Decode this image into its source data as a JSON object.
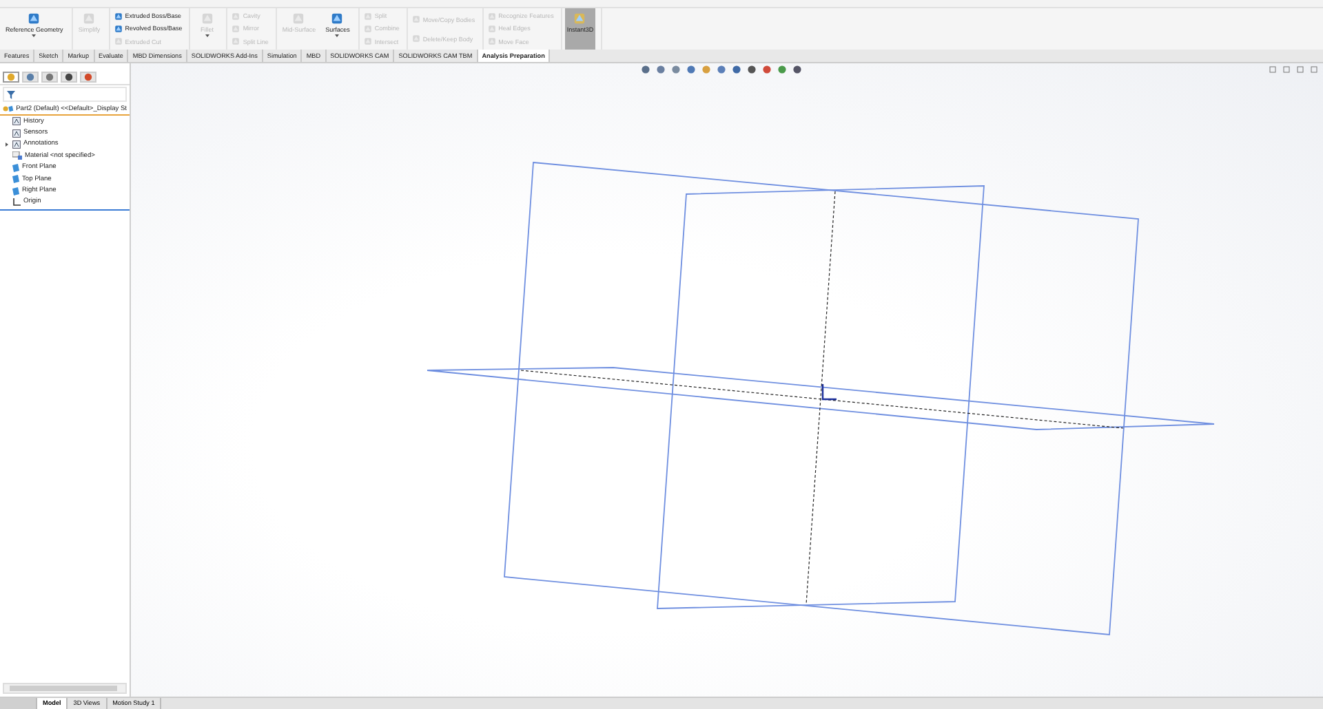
{
  "ribbon": {
    "groups": [
      {
        "kind": "large",
        "items": [
          {
            "label": "Reference Geometry",
            "disabled": false,
            "caret": true
          }
        ]
      },
      {
        "kind": "large",
        "items": [
          {
            "label": "Simplify",
            "disabled": true,
            "caret": false
          }
        ]
      },
      {
        "kind": "column",
        "items": [
          {
            "label": "Extruded Boss/Base",
            "disabled": false
          },
          {
            "label": "Revolved Boss/Base",
            "disabled": false
          },
          {
            "label": "Extruded Cut",
            "disabled": true
          }
        ]
      },
      {
        "kind": "large",
        "items": [
          {
            "label": "Fillet",
            "disabled": true,
            "caret": true
          }
        ]
      },
      {
        "kind": "column",
        "items": [
          {
            "label": "Cavity",
            "disabled": true
          },
          {
            "label": "Mirror",
            "disabled": true
          },
          {
            "label": "Split Line",
            "disabled": true
          }
        ]
      },
      {
        "kind": "large",
        "items": [
          {
            "label": "Mid-Surface",
            "disabled": true,
            "caret": false
          },
          {
            "label": "Surfaces",
            "disabled": false,
            "caret": true
          }
        ]
      },
      {
        "kind": "column",
        "items": [
          {
            "label": "Split",
            "disabled": true
          },
          {
            "label": "Combine",
            "disabled": true
          },
          {
            "label": "Intersect",
            "disabled": true
          }
        ]
      },
      {
        "kind": "column",
        "items": [
          {
            "label": "Move/Copy Bodies",
            "disabled": true
          },
          {
            "label": "Delete/Keep Body",
            "disabled": true
          }
        ]
      },
      {
        "kind": "column",
        "items": [
          {
            "label": "Recognize Features",
            "disabled": true
          },
          {
            "label": "Heal Edges",
            "disabled": true
          },
          {
            "label": "Move Face",
            "disabled": true
          }
        ]
      },
      {
        "kind": "pressed",
        "items": [
          {
            "label": "Instant3D",
            "disabled": false,
            "caret": false
          }
        ]
      }
    ]
  },
  "tabs": [
    {
      "label": "Features",
      "selected": false
    },
    {
      "label": "Sketch",
      "selected": false
    },
    {
      "label": "Markup",
      "selected": false
    },
    {
      "label": "Evaluate",
      "selected": false
    },
    {
      "label": "MBD Dimensions",
      "selected": false
    },
    {
      "label": "SOLIDWORKS Add-Ins",
      "selected": false
    },
    {
      "label": "Simulation",
      "selected": false
    },
    {
      "label": "MBD",
      "selected": false
    },
    {
      "label": "SOLIDWORKS CAM",
      "selected": false
    },
    {
      "label": "SOLIDWORKS CAM TBM",
      "selected": false
    },
    {
      "label": "Analysis Preparation",
      "selected": true
    }
  ],
  "panel_tabs": [
    {
      "kind": "feature-manager",
      "selected": true
    },
    {
      "kind": "property-manager",
      "selected": false
    },
    {
      "kind": "configuration-manager",
      "selected": false
    },
    {
      "kind": "dimxpert-manager",
      "selected": false
    },
    {
      "kind": "display-manager",
      "selected": false
    }
  ],
  "tree": {
    "root": "Part2 (Default) <<Default>_Display St",
    "items": [
      {
        "label": "History",
        "kind": "history",
        "expandable": false
      },
      {
        "label": "Sensors",
        "kind": "sensors",
        "expandable": false
      },
      {
        "label": "Annotations",
        "kind": "annotations",
        "expandable": true
      },
      {
        "label": "Material <not specified>",
        "kind": "material",
        "expandable": false
      },
      {
        "label": "Front Plane",
        "kind": "plane",
        "expandable": false
      },
      {
        "label": "Top Plane",
        "kind": "plane",
        "expandable": false
      },
      {
        "label": "Right Plane",
        "kind": "plane",
        "expandable": false
      },
      {
        "label": "Origin",
        "kind": "origin",
        "expandable": false
      }
    ]
  },
  "bottom_tabs": [
    {
      "label": "Model",
      "selected": true
    },
    {
      "label": "3D Views",
      "selected": false
    },
    {
      "label": "Motion Study 1",
      "selected": false
    }
  ]
}
